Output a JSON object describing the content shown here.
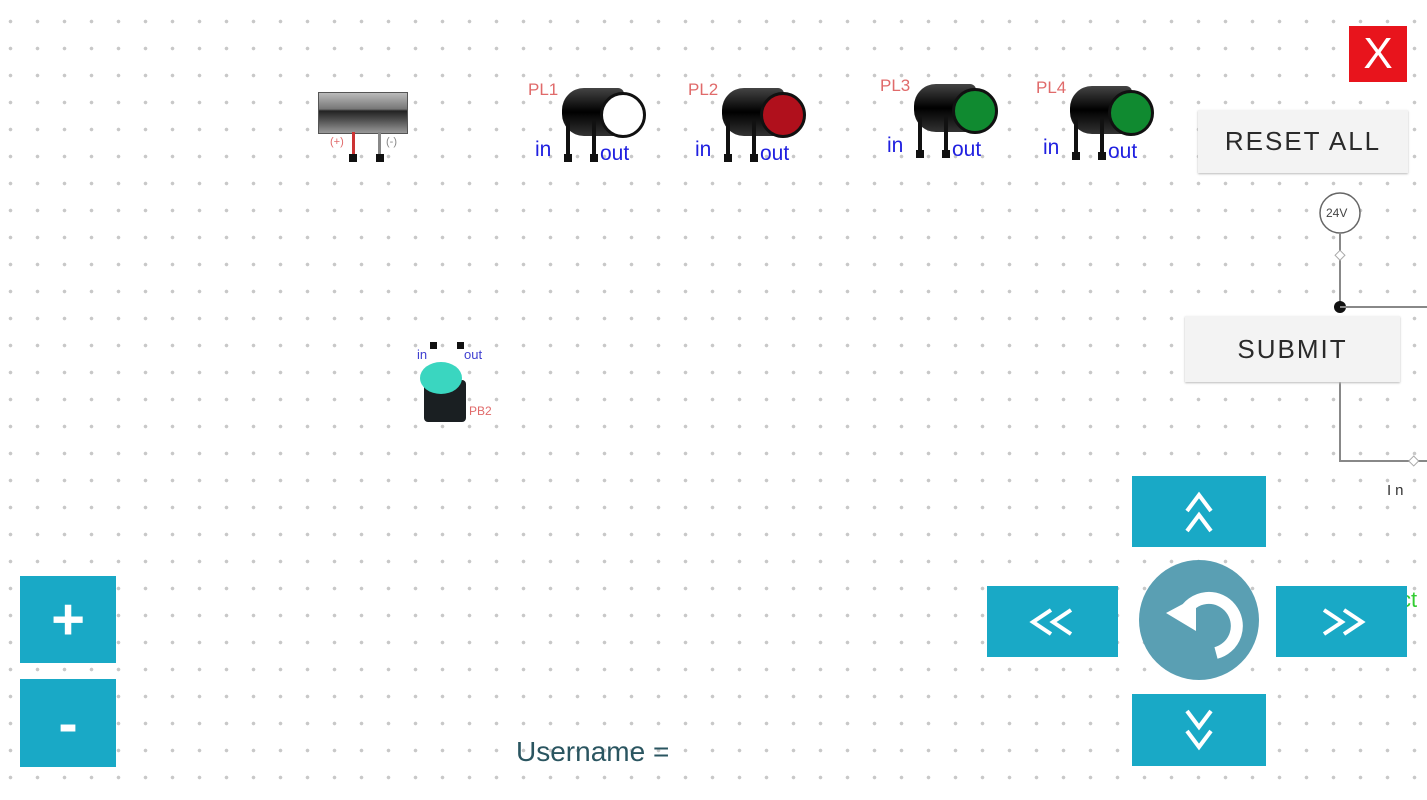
{
  "close_button": {
    "label": "X",
    "color": "#e8141c"
  },
  "reset_button": {
    "label": "RESET ALL"
  },
  "submit_button": {
    "label": "SUBMIT"
  },
  "power_supply": {
    "plus_label": "(+)",
    "minus_label": "(-)"
  },
  "lamps": [
    {
      "label": "PL1",
      "in": "in",
      "out": "out",
      "lens_color": "#ffffff"
    },
    {
      "label": "PL2",
      "in": "in",
      "out": "out",
      "lens_color": "#b0101c"
    },
    {
      "label": "PL3",
      "in": "in",
      "out": "out",
      "lens_color": "#108a30"
    },
    {
      "label": "PL4",
      "in": "in",
      "out": "out",
      "lens_color": "#108a30"
    }
  ],
  "pushbutton": {
    "label": "PB2",
    "in": "in",
    "out": "out",
    "cap_color": "#3ad6c0"
  },
  "circuit": {
    "source_label": "24V",
    "in_label": "In",
    "partial_label": "ct"
  },
  "zoom": {
    "plus": "+",
    "minus": "-"
  },
  "nav": {
    "up": "up-icon",
    "down": "down-icon",
    "left": "left-icon",
    "right": "right-icon",
    "reset": "rotate-icon",
    "color": "#19a9c6"
  },
  "username": {
    "label": "Username ="
  }
}
